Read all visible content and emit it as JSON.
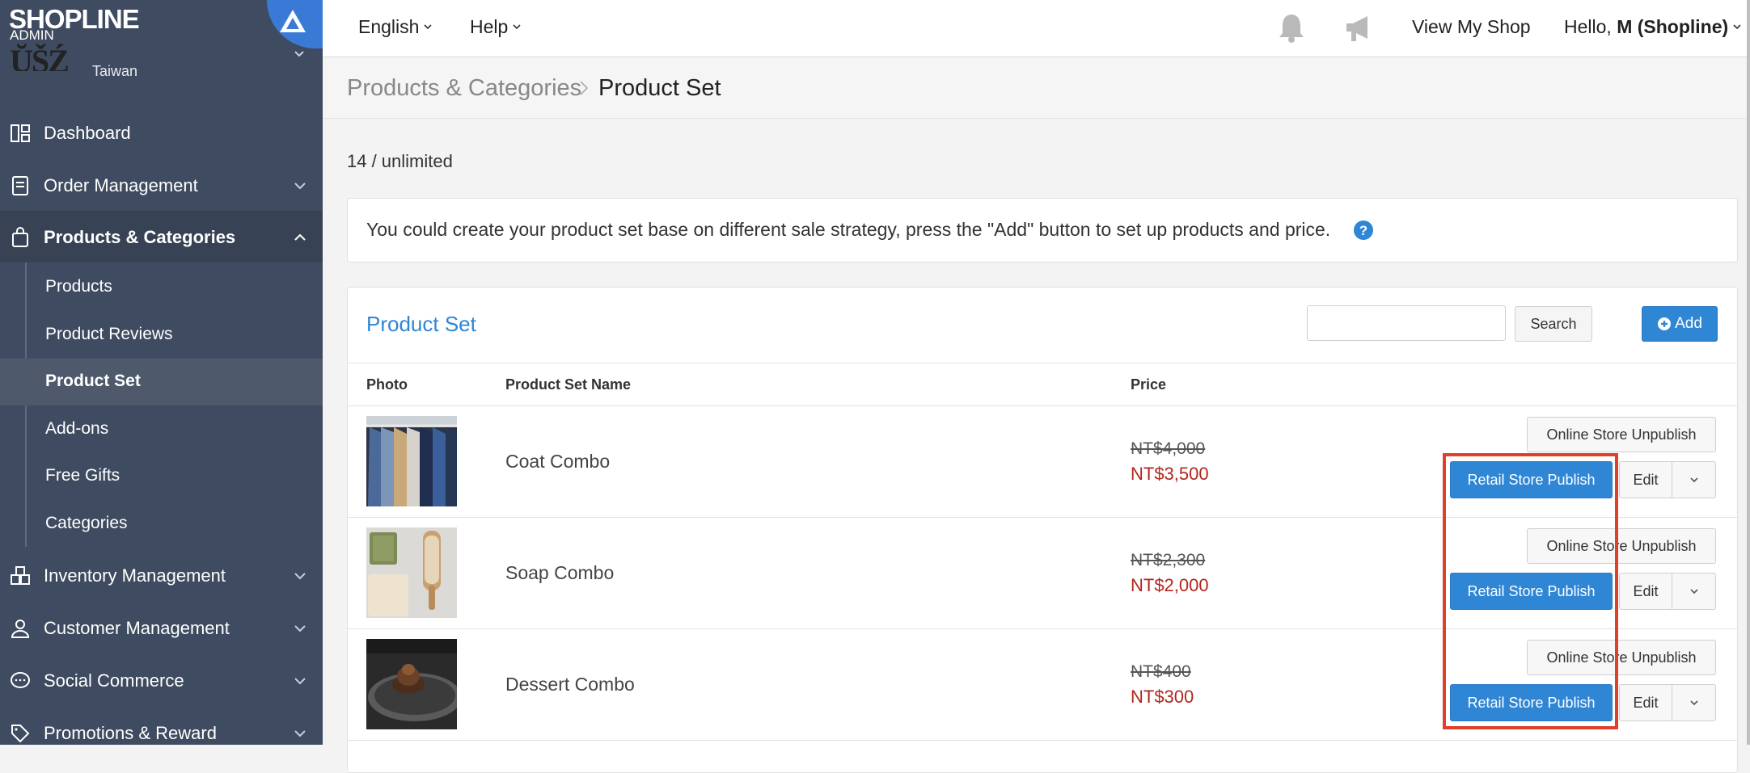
{
  "brand": {
    "logo_text": "SHOPLINE",
    "logo_sub": "ADMIN",
    "store_name_partial": "ŬŠŹ",
    "store_region": "Taiwan"
  },
  "sidebar": {
    "items": [
      {
        "label": "Dashboard",
        "icon": "dashboard-icon"
      },
      {
        "label": "Order Management",
        "icon": "order-icon"
      },
      {
        "label": "Products & Categories",
        "icon": "shopping-bag-icon"
      },
      {
        "label": "Inventory Management",
        "icon": "inventory-icon"
      },
      {
        "label": "Customer Management",
        "icon": "user-icon"
      },
      {
        "label": "Social Commerce",
        "icon": "chat-icon"
      },
      {
        "label": "Promotions & Reward",
        "icon": "tag-icon"
      }
    ],
    "sub_items": [
      {
        "label": "Products"
      },
      {
        "label": "Product Reviews"
      },
      {
        "label": "Product Set"
      },
      {
        "label": "Add-ons"
      },
      {
        "label": "Free Gifts"
      },
      {
        "label": "Categories"
      }
    ]
  },
  "topbar": {
    "language": "English",
    "help": "Help",
    "view_shop": "View My Shop",
    "hello": "Hello,",
    "user": "M (Shopline)"
  },
  "breadcrumb": {
    "parent": "Products & Categories",
    "current": "Product Set"
  },
  "quota": "14 / unlimited",
  "info": {
    "text": "You could create your product set base on different sale strategy, press the \"Add\" button to set up products and price."
  },
  "panel": {
    "title": "Product Set",
    "search_placeholder": "",
    "search_label": "Search",
    "add_label": "Add",
    "columns": {
      "photo": "Photo",
      "name": "Product Set Name",
      "price": "Price"
    },
    "row_actions": {
      "unpublish": "Online Store Unpublish",
      "publish": "Retail Store Publish",
      "edit": "Edit"
    },
    "rows": [
      {
        "name": "Coat Combo",
        "old_price": "NT$4,000",
        "new_price": "NT$3,500"
      },
      {
        "name": "Soap Combo",
        "old_price": "NT$2,300",
        "new_price": "NT$2,000"
      },
      {
        "name": "Dessert Combo",
        "old_price": "NT$400",
        "new_price": "NT$300"
      }
    ]
  },
  "colors": {
    "sidebar": "#3f4b60",
    "accent": "#2f86d5",
    "sale_price": "#b3261e",
    "highlight": "#e0402b"
  }
}
